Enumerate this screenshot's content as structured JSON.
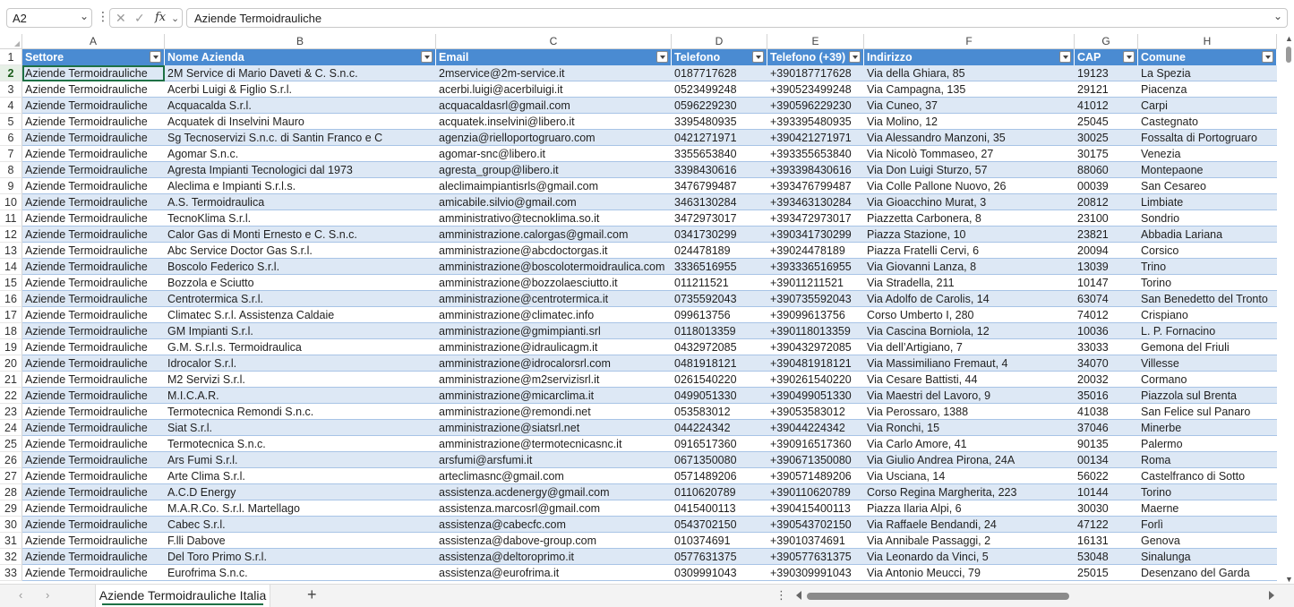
{
  "formula_bar": {
    "name_box": "A2",
    "formula": "Aziende Termoidrauliche"
  },
  "columns": [
    "A",
    "B",
    "C",
    "D",
    "E",
    "F",
    "G",
    "H"
  ],
  "headers": [
    "Settore",
    "Nome Azienda",
    "Email",
    "Telefono",
    "Telefono (+39)",
    "Indirizzo",
    "CAP",
    "Comune"
  ],
  "rows": [
    {
      "n": "2",
      "c": [
        "Aziende Termoidrauliche",
        "2M Service di Mario Daveti & C. S.n.c.",
        "2mservice@2m-service.it",
        "0187717628",
        "+390187717628",
        "Via della Ghiara, 85",
        "19123",
        "La Spezia"
      ]
    },
    {
      "n": "3",
      "c": [
        "Aziende Termoidrauliche",
        "Acerbi Luigi & Figlio S.r.l.",
        "acerbi.luigi@acerbiluigi.it",
        "0523499248",
        "+390523499248",
        "Via Campagna, 135",
        "29121",
        "Piacenza"
      ]
    },
    {
      "n": "4",
      "c": [
        "Aziende Termoidrauliche",
        "Acquacalda S.r.l.",
        "acquacaldasrl@gmail.com",
        "0596229230",
        "+390596229230",
        "Via Cuneo, 37",
        "41012",
        "Carpi"
      ]
    },
    {
      "n": "5",
      "c": [
        "Aziende Termoidrauliche",
        "Acquatek di Inselvini Mauro",
        "acquatek.inselvini@libero.it",
        "3395480935",
        "+393395480935",
        "Via Molino, 12",
        "25045",
        "Castegnato"
      ]
    },
    {
      "n": "6",
      "c": [
        "Aziende Termoidrauliche",
        "Sg Tecnoservizi S.n.c. di Santin Franco e C",
        "agenzia@rielloportogruaro.com",
        "0421271971",
        "+390421271971",
        "Via Alessandro Manzoni, 35",
        "30025",
        "Fossalta di Portogruaro"
      ]
    },
    {
      "n": "7",
      "c": [
        "Aziende Termoidrauliche",
        "Agomar S.n.c.",
        "agomar-snc@libero.it",
        "3355653840",
        "+393355653840",
        "Via Nicolò Tommaseo, 27",
        "30175",
        "Venezia"
      ]
    },
    {
      "n": "8",
      "c": [
        "Aziende Termoidrauliche",
        "Agresta Impianti Tecnologici dal 1973",
        "agresta_group@libero.it",
        "3398430616",
        "+393398430616",
        "Via Don Luigi Sturzo, 57",
        "88060",
        "Montepaone"
      ]
    },
    {
      "n": "9",
      "c": [
        "Aziende Termoidrauliche",
        "Aleclima e Impianti S.r.l.s.",
        "aleclimaimpiantisrls@gmail.com",
        "3476799487",
        "+393476799487",
        "Via Colle Pallone Nuovo, 26",
        "00039",
        "San Cesareo"
      ]
    },
    {
      "n": "10",
      "c": [
        "Aziende Termoidrauliche",
        "A.S. Termoidraulica",
        "amicabile.silvio@gmail.com",
        "3463130284",
        "+393463130284",
        "Via Gioacchino Murat, 3",
        "20812",
        "Limbiate"
      ]
    },
    {
      "n": "11",
      "c": [
        "Aziende Termoidrauliche",
        "TecnoKlima S.r.l.",
        "amministrativo@tecnoklima.so.it",
        "3472973017",
        "+393472973017",
        "Piazzetta Carbonera, 8",
        "23100",
        "Sondrio"
      ]
    },
    {
      "n": "12",
      "c": [
        "Aziende Termoidrauliche",
        "Calor Gas di Monti Ernesto e C. S.n.c.",
        "amministrazione.calorgas@gmail.com",
        "0341730299",
        "+390341730299",
        "Piazza Stazione, 10",
        "23821",
        "Abbadia Lariana"
      ]
    },
    {
      "n": "13",
      "c": [
        "Aziende Termoidrauliche",
        "Abc Service Doctor Gas S.r.l.",
        "amministrazione@abcdoctorgas.it",
        "024478189",
        "+39024478189",
        "Piazza Fratelli Cervi, 6",
        "20094",
        "Corsico"
      ]
    },
    {
      "n": "14",
      "c": [
        "Aziende Termoidrauliche",
        "Boscolo Federico S.r.l.",
        "amministrazione@boscolotermoidraulica.com",
        "3336516955",
        "+393336516955",
        "Via Giovanni Lanza, 8",
        "13039",
        "Trino"
      ]
    },
    {
      "n": "15",
      "c": [
        "Aziende Termoidrauliche",
        "Bozzola e Sciutto",
        "amministrazione@bozzolaesciutto.it",
        "011211521",
        "+39011211521",
        "Via Stradella, 211",
        "10147",
        "Torino"
      ]
    },
    {
      "n": "16",
      "c": [
        "Aziende Termoidrauliche",
        "Centrotermica S.r.l.",
        "amministrazione@centrotermica.it",
        "0735592043",
        "+390735592043",
        "Via Adolfo de Carolis, 14",
        "63074",
        "San Benedetto del Tronto"
      ]
    },
    {
      "n": "17",
      "c": [
        "Aziende Termoidrauliche",
        "Climatec S.r.l. Assistenza Caldaie",
        "amministrazione@climatec.info",
        "099613756",
        "+39099613756",
        "Corso Umberto I, 280",
        "74012",
        "Crispiano"
      ]
    },
    {
      "n": "18",
      "c": [
        "Aziende Termoidrauliche",
        "GM Impianti S.r.l.",
        "amministrazione@gmimpianti.srl",
        "0118013359",
        "+390118013359",
        "Via Cascina Borniola, 12",
        "10036",
        "L. P. Fornacino"
      ]
    },
    {
      "n": "19",
      "c": [
        "Aziende Termoidrauliche",
        "G.M. S.r.l.s. Termoidraulica",
        "amministrazione@idraulicagm.it",
        "0432972085",
        "+390432972085",
        "Via dell’Artigiano, 7",
        "33033",
        "Gemona del Friuli"
      ]
    },
    {
      "n": "20",
      "c": [
        "Aziende Termoidrauliche",
        "Idrocalor S.r.l.",
        "amministrazione@idrocalorsrl.com",
        "0481918121",
        "+390481918121",
        "Via Massimiliano Fremaut, 4",
        "34070",
        "Villesse"
      ]
    },
    {
      "n": "21",
      "c": [
        "Aziende Termoidrauliche",
        "M2 Servizi S.r.l.",
        "amministrazione@m2servizisrl.it",
        "0261540220",
        "+390261540220",
        "Via Cesare Battisti, 44",
        "20032",
        "Cormano"
      ]
    },
    {
      "n": "22",
      "c": [
        "Aziende Termoidrauliche",
        "M.I.C.A.R.",
        "amministrazione@micarclima.it",
        "0499051330",
        "+390499051330",
        "Via Maestri del Lavoro, 9",
        "35016",
        "Piazzola sul Brenta"
      ]
    },
    {
      "n": "23",
      "c": [
        "Aziende Termoidrauliche",
        "Termotecnica Remondi S.n.c.",
        "amministrazione@remondi.net",
        "053583012",
        "+39053583012",
        "Via Perossaro, 1388",
        "41038",
        "San Felice sul Panaro"
      ]
    },
    {
      "n": "24",
      "c": [
        "Aziende Termoidrauliche",
        "Siat S.r.l.",
        "amministrazione@siatsrl.net",
        "044224342",
        "+39044224342",
        "Via Ronchi, 15",
        "37046",
        "Minerbe"
      ]
    },
    {
      "n": "25",
      "c": [
        "Aziende Termoidrauliche",
        "Termotecnica S.n.c.",
        "amministrazione@termotecnicasnc.it",
        "0916517360",
        "+390916517360",
        "Via Carlo Amore, 41",
        "90135",
        "Palermo"
      ]
    },
    {
      "n": "26",
      "c": [
        "Aziende Termoidrauliche",
        "Ars Fumi S.r.l.",
        "arsfumi@arsfumi.it",
        "0671350080",
        "+390671350080",
        "Via Giulio Andrea Pirona, 24A",
        "00134",
        "Roma"
      ]
    },
    {
      "n": "27",
      "c": [
        "Aziende Termoidrauliche",
        "Arte Clima S.r.l.",
        "arteclimasnc@gmail.com",
        "0571489206",
        "+390571489206",
        "Via Usciana, 14",
        "56022",
        "Castelfranco di Sotto"
      ]
    },
    {
      "n": "28",
      "c": [
        "Aziende Termoidrauliche",
        "A.C.D Energy",
        "assistenza.acdenergy@gmail.com",
        "0110620789",
        "+390110620789",
        "Corso Regina Margherita, 223",
        "10144",
        "Torino"
      ]
    },
    {
      "n": "29",
      "c": [
        "Aziende Termoidrauliche",
        "M.A.R.Co. S.r.l. Martellago",
        "assistenza.marcosrl@gmail.com",
        "0415400113",
        "+390415400113",
        "Piazza Ilaria Alpi, 6",
        "30030",
        "Maerne"
      ]
    },
    {
      "n": "30",
      "c": [
        "Aziende Termoidrauliche",
        "Cabec S.r.l.",
        "assistenza@cabecfc.com",
        "0543702150",
        "+390543702150",
        "Via Raffaele Bendandi, 24",
        "47122",
        "Forlì"
      ]
    },
    {
      "n": "31",
      "c": [
        "Aziende Termoidrauliche",
        "F.lli Dabove",
        "assistenza@dabove-group.com",
        "010374691",
        "+39010374691",
        "Via Annibale Passaggi, 2",
        "16131",
        "Genova"
      ]
    },
    {
      "n": "32",
      "c": [
        "Aziende Termoidrauliche",
        "Del Toro Primo S.r.l.",
        "assistenza@deltoroprimo.it",
        "0577631375",
        "+390577631375",
        "Via Leonardo da Vinci, 5",
        "53048",
        "Sinalunga"
      ]
    },
    {
      "n": "33",
      "c": [
        "Aziende Termoidrauliche",
        "Eurofrima S.n.c.",
        "assistenza@eurofrima.it",
        "0309991043",
        "+390309991043",
        "Via Antonio Meucci, 79",
        "25015",
        "Desenzano del Garda"
      ]
    }
  ],
  "sheet_tab": "Aziende Termoidrauliche Italia",
  "icons": {
    "name_box_chevron": "chevron-down-icon",
    "cancel": "close-icon",
    "confirm": "check-icon",
    "function": "fx-icon",
    "add_sheet": "plus-icon"
  },
  "colors": {
    "header_fill": "#4a8bd2",
    "band_fill": "#dde8f5",
    "selection": "#1e7145"
  }
}
